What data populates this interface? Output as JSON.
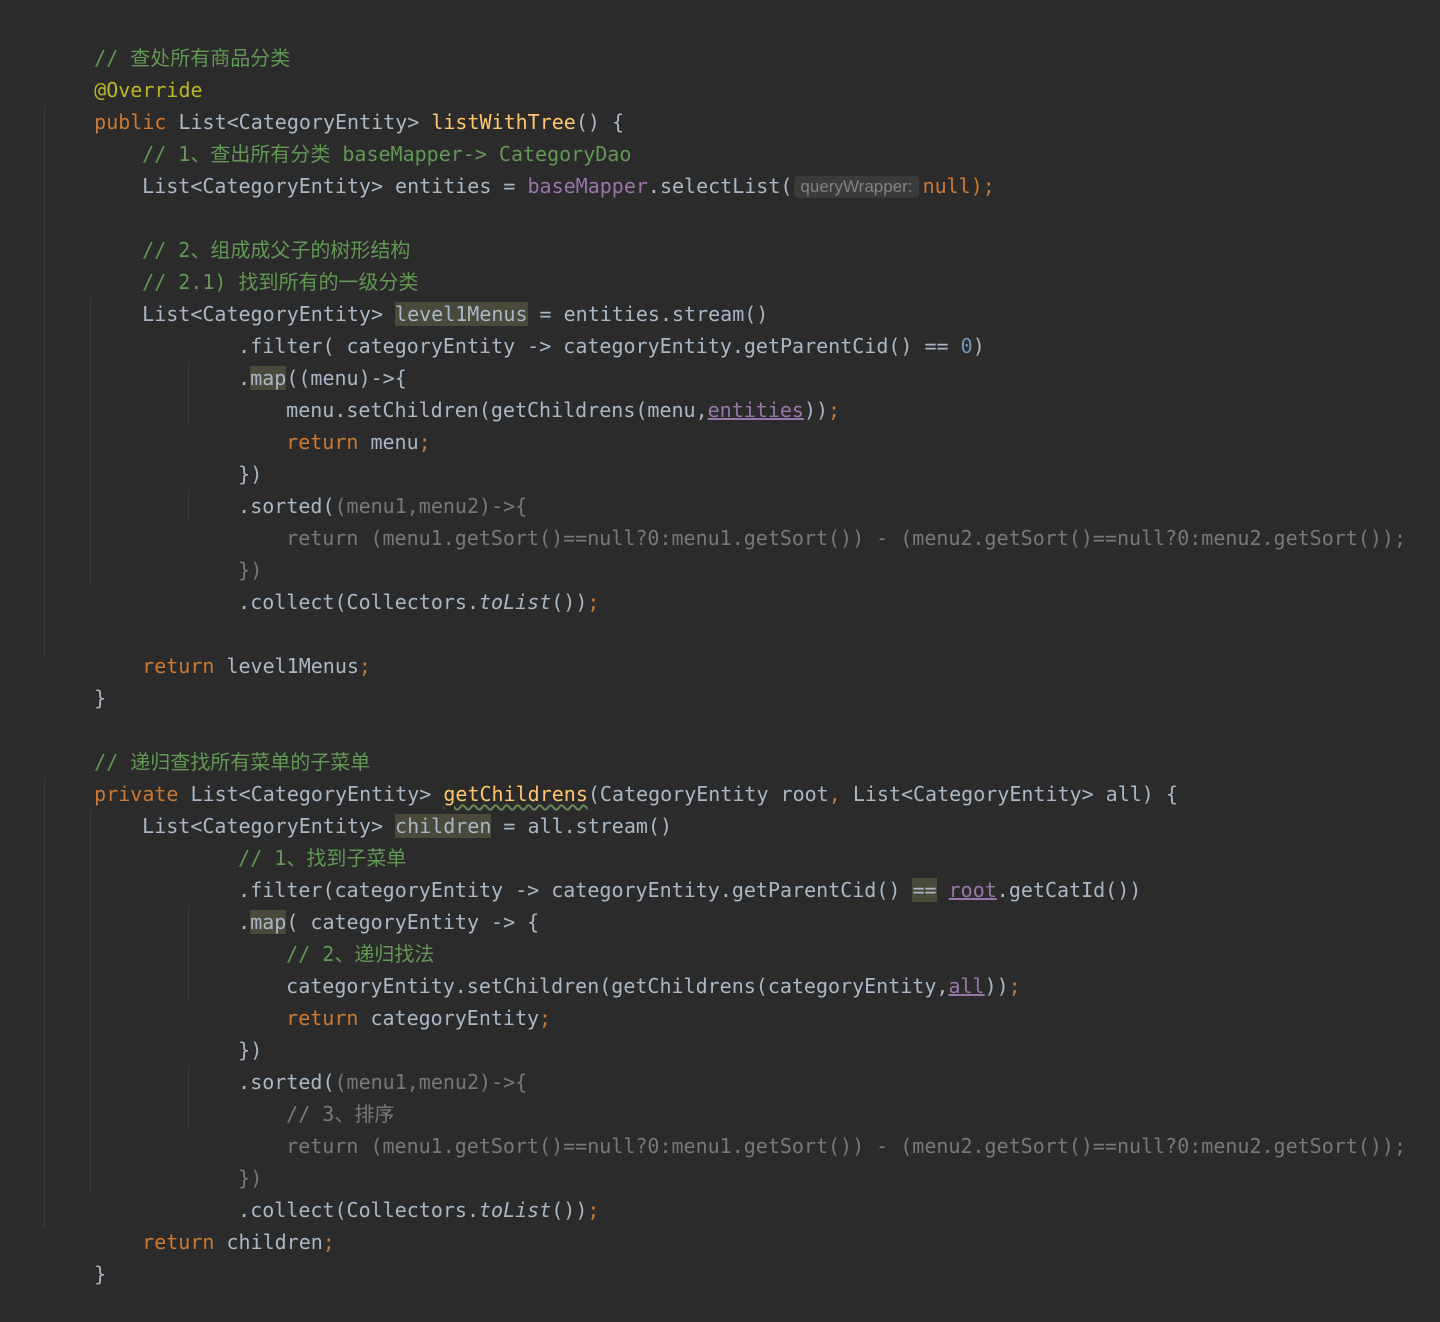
{
  "code": {
    "comment_list_all": "// 查处所有商品分类",
    "annotation": "@Override",
    "kw_public": "public",
    "type_list_entity": "List<CategoryEntity>",
    "method_list_with_tree": "listWithTree",
    "paren_open_brace": "() {",
    "comment_step1": "// 1、查出所有分类 baseMapper-> CategoryDao",
    "var_entities": "entities",
    "op_assign": " = ",
    "field_base_mapper": "baseMapper",
    "call_select_list": ".selectList(",
    "hint_query_wrapper": "queryWrapper:",
    "kw_null": "null",
    "close_semicolon": ");",
    "comment_step2": "// 2、组成成父子的树形结构",
    "comment_step2_1": "// 2.1) 找到所有的一级分类",
    "var_level1menus": "level1Menus",
    "entities_stream": "entities.stream()",
    "filter_open": ".filter( categoryEntity -> categoryEntity.getParentCid() == ",
    "num_zero": "0",
    "paren_close": ")",
    "dot": ".",
    "map_word": "map",
    "map_menu_open": "((menu)->{",
    "menu_set_children": "menu.setChildren(getChildrens(menu,",
    "entities_ref": "entities",
    "double_close": "))",
    "semicolon": ";",
    "kw_return": "return",
    "menu_word": " menu",
    "brace_paren_close": "})",
    "sorted_word": ".sorted(",
    "sorted_params": "(menu1,menu2)->{",
    "sort_return_expr": "return (menu1.getSort()==null?0:menu1.getSort()) - (menu2.getSort()==null?0:menu2.getSort());",
    "collect_open": ".collect(Collectors.",
    "to_list": "toList",
    "collect_close": "())",
    "return_level1": " level1Menus",
    "close_brace": "}",
    "comment_recursive": "// 递归查找所有菜单的子菜单",
    "kw_private": "private",
    "method_get_childrens": "getChildrens",
    "param_root": "(CategoryEntity root",
    "comma": ", ",
    "param_all": "List<CategoryEntity> all) {",
    "var_children": "children",
    "all_stream": "all.stream()",
    "comment_find_sub": "// 1、找到子菜单",
    "filter2_open": ".filter(categoryEntity -> categoryEntity.getParentCid() ",
    "op_eq": "==",
    "root_ref": "root",
    "get_cat_id": ".getCatId())",
    "map2_open": "( categoryEntity -> {",
    "comment_recursive_find": "// 2、递归找法",
    "set_children2": "categoryEntity.setChildren(getChildrens(categoryEntity,",
    "all_ref": "all",
    "return_category_entity": " categoryEntity",
    "comment_sort": "// 3、排序",
    "return_children": " children"
  }
}
